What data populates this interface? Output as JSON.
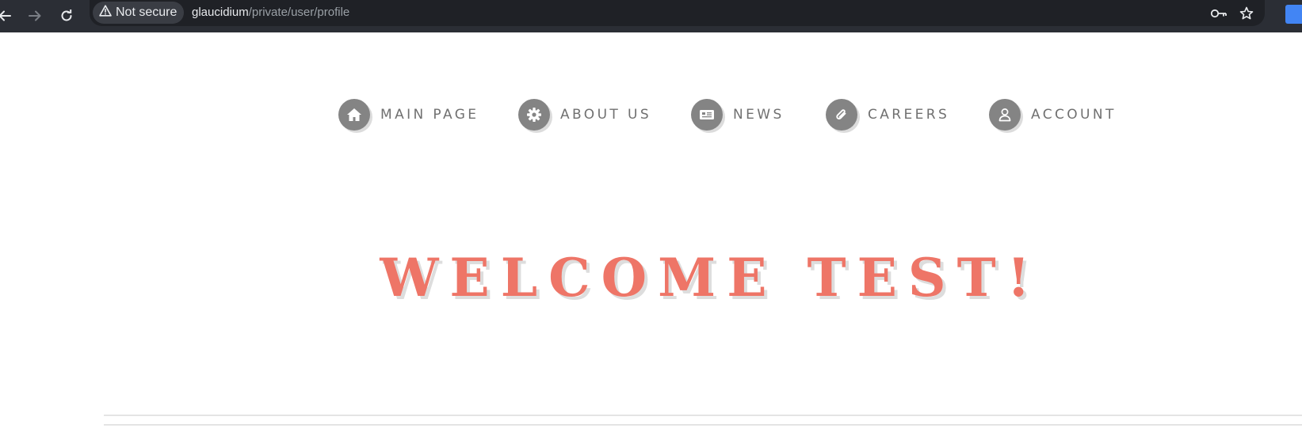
{
  "browser": {
    "security_label": "Not secure",
    "url_host": "glaucidium",
    "url_path": "/private/user/profile",
    "icons": [
      "back-arrow-icon",
      "forward-arrow-icon",
      "reload-icon",
      "warning-icon",
      "key-icon",
      "star-icon",
      "translate-icon"
    ]
  },
  "nav": {
    "items": [
      {
        "label": "MAIN PAGE",
        "icon": "home-icon"
      },
      {
        "label": "ABOUT US",
        "icon": "gear-icon"
      },
      {
        "label": "NEWS",
        "icon": "newspaper-icon"
      },
      {
        "label": "CAREERS",
        "icon": "paperclip-icon"
      },
      {
        "label": "ACCOUNT",
        "icon": "user-icon"
      }
    ]
  },
  "hero": {
    "title": "WELCOME TEST!"
  },
  "colors": {
    "accent": "#ee7567",
    "nav_icon_bg": "#848484",
    "nav_text": "#707070",
    "browser_bar": "#2b2e35",
    "omnibox": "#1f2126"
  }
}
